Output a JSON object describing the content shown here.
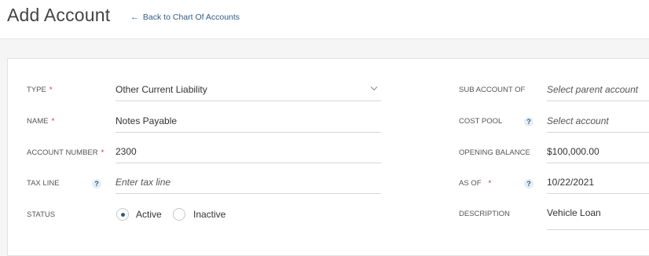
{
  "header": {
    "title": "Add Account",
    "back_arrow": "←",
    "back_link": "Back to Chart Of Accounts"
  },
  "form": {
    "required_marker": "*",
    "help_glyph": "?",
    "type": {
      "label": "TYPE",
      "value": "Other Current Liability",
      "icon": "chevron-down-icon"
    },
    "name": {
      "label": "NAME",
      "value": "Notes Payable"
    },
    "account_number": {
      "label": "ACCOUNT NUMBER",
      "value": "2300"
    },
    "tax_line": {
      "label": "TAX LINE",
      "placeholder": "Enter tax line"
    },
    "status": {
      "label": "STATUS",
      "options": [
        "Active",
        "Inactive"
      ],
      "selected": "Active"
    },
    "sub_account_of": {
      "label": "SUB ACCOUNT OF",
      "placeholder": "Select parent account"
    },
    "cost_pool": {
      "label": "COST POOL",
      "placeholder": "Select account"
    },
    "opening_balance": {
      "label": "OPENING BALANCE",
      "value": "$100,000.00"
    },
    "as_of": {
      "label": "AS OF",
      "value": "10/22/2021"
    },
    "description": {
      "label": "DESCRIPTION",
      "value": "Vehicle Loan"
    }
  },
  "colors": {
    "accent": "#2f5d86",
    "required": "#d6262b",
    "background": "#f5f5f5"
  }
}
